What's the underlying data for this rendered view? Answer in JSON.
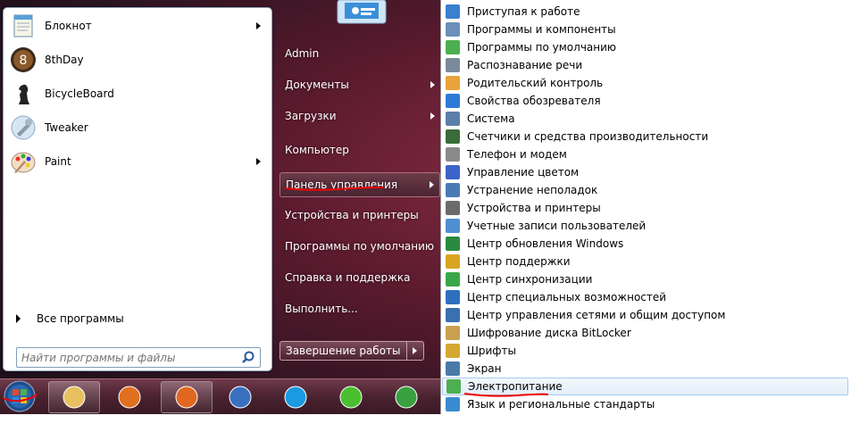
{
  "start_menu": {
    "programs": [
      {
        "label": "Блокнот",
        "icon": "notepad-icon",
        "has_submenu": true
      },
      {
        "label": "8thDay",
        "icon": "8thday-icon",
        "has_submenu": false
      },
      {
        "label": "BicycleBoard",
        "icon": "chess-knight-icon",
        "has_submenu": false
      },
      {
        "label": "Tweaker",
        "icon": "tweaker-icon",
        "has_submenu": false
      },
      {
        "label": "Paint",
        "icon": "paint-palette-icon",
        "has_submenu": true
      }
    ],
    "all_programs": "Все программы",
    "search_placeholder": "Найти программы и файлы",
    "right_links": [
      {
        "label": "Admin",
        "has_submenu": false
      },
      {
        "label": "Документы",
        "has_submenu": true
      },
      {
        "label": "Загрузки",
        "has_submenu": true
      },
      {
        "label": "Компьютер",
        "has_submenu": false
      },
      {
        "label": "Панель управления",
        "has_submenu": true,
        "selected": true
      },
      {
        "label": "Устройства и принтеры",
        "has_submenu": false
      },
      {
        "label": "Программы по умолчанию",
        "has_submenu": false
      },
      {
        "label": "Справка и поддержка",
        "has_submenu": false
      },
      {
        "label": "Выполнить...",
        "has_submenu": false
      }
    ],
    "shutdown_label": "Завершение работы"
  },
  "control_panel_items": [
    {
      "label": "Приступая к работе",
      "color": "#3a7fd0"
    },
    {
      "label": "Программы и компоненты",
      "color": "#6a8fb8"
    },
    {
      "label": "Программы по умолчанию",
      "color": "#4caf50"
    },
    {
      "label": "Распознавание речи",
      "color": "#7a8a9a"
    },
    {
      "label": "Родительский контроль",
      "color": "#e8a33a"
    },
    {
      "label": "Свойства обозревателя",
      "color": "#2d7bd6"
    },
    {
      "label": "Система",
      "color": "#5b7fa8"
    },
    {
      "label": "Счетчики и средства производительности",
      "color": "#3a6b3a"
    },
    {
      "label": "Телефон и модем",
      "color": "#8a8a8a"
    },
    {
      "label": "Управление цветом",
      "color": "#3c64c8"
    },
    {
      "label": "Устранение неполадок",
      "color": "#4a7ab5"
    },
    {
      "label": "Устройства и принтеры",
      "color": "#6b6b6b"
    },
    {
      "label": "Учетные записи пользователей",
      "color": "#4d8fd1"
    },
    {
      "label": "Центр обновления Windows",
      "color": "#2a8a3e"
    },
    {
      "label": "Центр поддержки",
      "color": "#d9a520"
    },
    {
      "label": "Центр синхронизации",
      "color": "#3aa64a"
    },
    {
      "label": "Центр специальных возможностей",
      "color": "#2f6fc0"
    },
    {
      "label": "Центр управления сетями и общим доступом",
      "color": "#3a6fb0"
    },
    {
      "label": "Шифрование диска BitLocker",
      "color": "#c8a050"
    },
    {
      "label": "Шрифты",
      "color": "#d4a830"
    },
    {
      "label": "Экран",
      "color": "#4a7aa8"
    },
    {
      "label": "Электропитание",
      "color": "#4caf50",
      "hover": true
    },
    {
      "label": "Язык и региональные стандарты",
      "color": "#3a8ad0"
    }
  ],
  "taskbar": {
    "buttons": [
      {
        "name": "explorer-icon",
        "pinned": true
      },
      {
        "name": "media-player-icon",
        "pinned": false
      },
      {
        "name": "firefox-icon",
        "pinned": true
      },
      {
        "name": "thunderbird-icon",
        "pinned": false
      },
      {
        "name": "skype-icon",
        "pinned": false
      },
      {
        "name": "icq-icon",
        "pinned": false
      },
      {
        "name": "utorrent-icon",
        "pinned": false
      }
    ]
  }
}
